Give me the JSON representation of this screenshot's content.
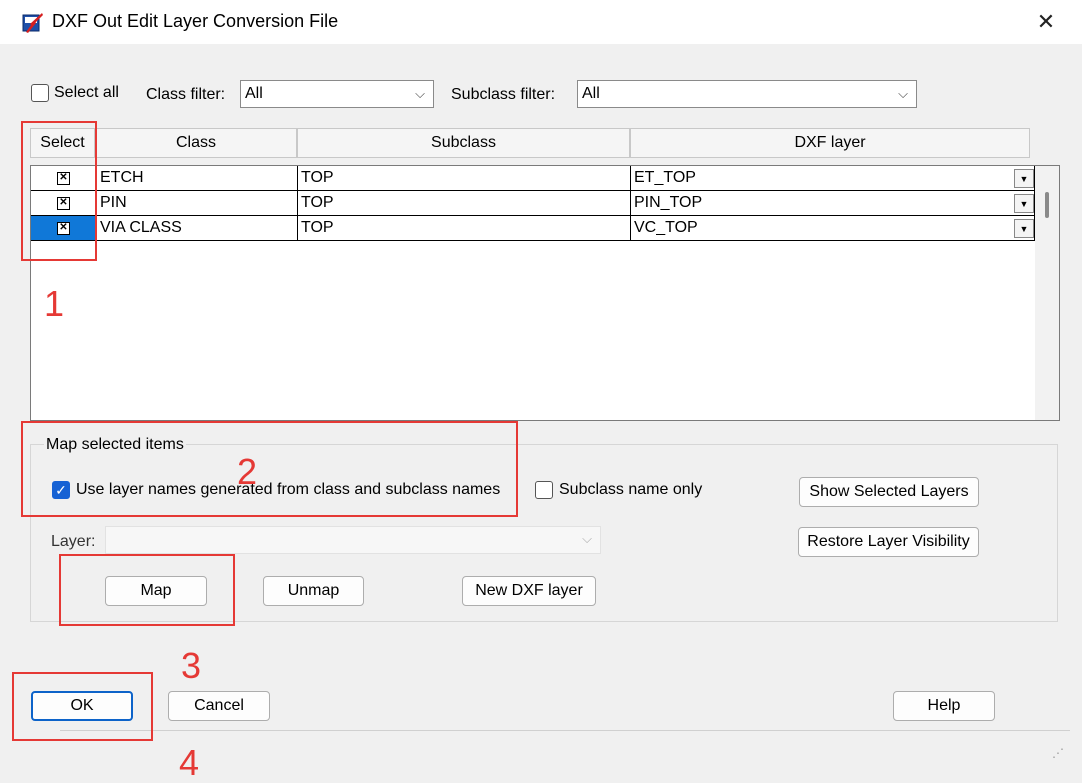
{
  "window": {
    "title": "DXF Out Edit Layer Conversion File",
    "close_glyph": "✕",
    "icon": "dxf-app-icon"
  },
  "filters": {
    "select_all_label": "Select all",
    "select_all_checked": false,
    "class_filter_label": "Class filter:",
    "class_filter_value": "All",
    "subclass_filter_label": "Subclass filter:",
    "subclass_filter_value": "All"
  },
  "table": {
    "headers": [
      "Select",
      "Class",
      "Subclass",
      "DXF layer"
    ],
    "rows": [
      {
        "selected": true,
        "highlighted": false,
        "class": "ETCH",
        "subclass": "TOP",
        "dxf_layer": "ET_TOP"
      },
      {
        "selected": true,
        "highlighted": false,
        "class": "PIN",
        "subclass": "TOP",
        "dxf_layer": "PIN_TOP"
      },
      {
        "selected": true,
        "highlighted": true,
        "class": "VIA CLASS",
        "subclass": "TOP",
        "dxf_layer": "VC_TOP"
      }
    ]
  },
  "map_group": {
    "title": "Map selected items",
    "use_generated_names_label": "Use layer names generated from class and subclass names",
    "use_generated_names_checked": true,
    "subclass_only_label": "Subclass name only",
    "subclass_only_checked": false,
    "layer_label": "Layer:",
    "layer_value": "",
    "map_label": "Map",
    "unmap_label": "Unmap",
    "new_layer_label": "New DXF layer",
    "show_selected_label": "Show Selected Layers",
    "restore_visibility_label": "Restore Layer Visibility"
  },
  "footer": {
    "ok_label": "OK",
    "cancel_label": "Cancel",
    "help_label": "Help"
  },
  "annotations": {
    "labels": [
      "1",
      "2",
      "3",
      "4"
    ],
    "color": "#e53935"
  },
  "colors": {
    "accent": "#1662d4",
    "row_highlight": "#1078d8"
  }
}
